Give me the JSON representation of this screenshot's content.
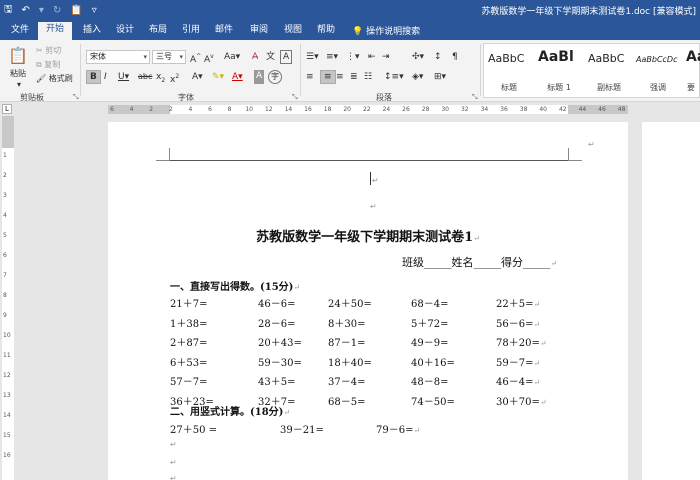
{
  "titlebar": {
    "doc_title": "苏教版数学一年级下学期期末测试卷1.doc [兼容模式]"
  },
  "tabs": [
    "文件",
    "开始",
    "插入",
    "设计",
    "布局",
    "引用",
    "邮件",
    "审阅",
    "视图",
    "帮助"
  ],
  "tell_me": "操作说明搜索",
  "clipboard": {
    "paste": "粘贴",
    "cut": "剪切",
    "copy": "复制",
    "format_painter": "格式刷",
    "group_label": "剪贴板"
  },
  "font": {
    "name": "宋体",
    "size": "三号",
    "group_label": "字体"
  },
  "paragraph": {
    "group_label": "段落"
  },
  "styles": [
    {
      "sample": "AaBbC",
      "name": "标题"
    },
    {
      "sample": "AaBl",
      "name": "标题 1"
    },
    {
      "sample": "AaBbC",
      "name": "副标题"
    },
    {
      "sample": "AaBbCcDc",
      "name": "强调"
    },
    {
      "sample": "AaBl",
      "name": "要"
    }
  ],
  "ruler_numbers": [
    "6",
    "4",
    "2",
    "2",
    "4",
    "6",
    "8",
    "10",
    "12",
    "14",
    "16",
    "18",
    "20",
    "22",
    "24",
    "26",
    "28",
    "30",
    "32",
    "34",
    "36",
    "38",
    "40",
    "42",
    "44",
    "46",
    "48"
  ],
  "vruler_numbers": [
    "1",
    "2",
    "3",
    "4",
    "5",
    "6",
    "7",
    "8",
    "9",
    "10",
    "11",
    "12",
    "13",
    "14",
    "15",
    "16"
  ],
  "document": {
    "heading": "苏教版数学一年级下学期期末测试卷1",
    "info_line": "班级_____姓名_____得分_____",
    "section1": "一、直接写出得数。(15分)",
    "rows": [
      [
        "21＋7=",
        "46－6=",
        "24＋50=",
        "68－4=",
        "22＋5="
      ],
      [
        "1＋38=",
        "28－6=",
        "8＋30=",
        "5＋72=",
        "56－6="
      ],
      [
        "2＋87=",
        "20＋43=",
        "87－1=",
        "49－9=",
        "78＋20="
      ],
      [
        "6＋53=",
        "59－30=",
        "18＋40=",
        "40＋16=",
        "59－7="
      ],
      [
        "57－7=",
        "43＋5=",
        "37－4=",
        "48－8=",
        "46－4="
      ],
      [
        "36＋23=",
        "32＋7=",
        "68－5=",
        "74－50=",
        "30＋70="
      ]
    ],
    "section2": "二、用竖式计算。(18分)",
    "vertical_calc": [
      "27＋50 =",
      "39－21=",
      "79－6="
    ]
  }
}
